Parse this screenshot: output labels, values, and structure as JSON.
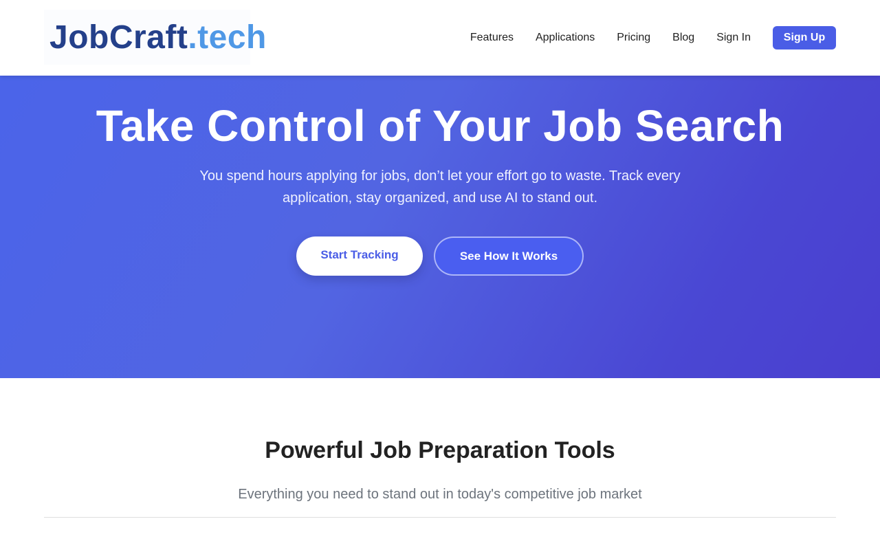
{
  "header": {
    "logo": {
      "main": "JobCraft",
      "ext": ".tech"
    },
    "nav": [
      {
        "label": "Features"
      },
      {
        "label": "Applications"
      },
      {
        "label": "Pricing"
      },
      {
        "label": "Blog"
      },
      {
        "label": "Sign In"
      }
    ],
    "signup_label": "Sign Up"
  },
  "hero": {
    "title": "Take Control of Your Job Search",
    "subtitle": "You spend hours applying for jobs, don’t let your effort go to waste. Track every application, stay organized, and use AI to stand out.",
    "primary_label": "Start Tracking",
    "secondary_label": "See How It Works"
  },
  "features": {
    "title": "Powerful Job Preparation Tools",
    "subtitle": "Everything you need to stand out in today's competitive job market"
  },
  "colors": {
    "brand_dark": "#24408a",
    "brand_light": "#4f98e6",
    "accent": "#4a5de6",
    "hero_gradient_start": "#4a64ea",
    "hero_gradient_end": "#4a3fcf"
  }
}
